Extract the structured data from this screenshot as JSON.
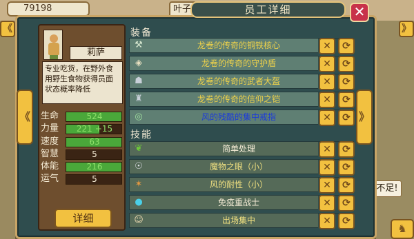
{
  "background": {
    "gold": "79198",
    "label": "叶子",
    "notice": "不足!"
  },
  "dialog": {
    "title": "员工详细",
    "close_symbol": "✕"
  },
  "character": {
    "name": "莉萨",
    "description": "专业吃货，在野外食用野生食物获得员面状态概率降低",
    "detail_button": "详细",
    "stats": [
      {
        "label": "生命",
        "value": "524",
        "bonus": "",
        "fill": 1.0
      },
      {
        "label": "力量",
        "value": "221",
        "bonus": "+15",
        "fill": 0.6
      },
      {
        "label": "速度",
        "value": "63",
        "bonus": "",
        "fill": 1.0
      },
      {
        "label": "智慧",
        "value": "5",
        "bonus": "",
        "fill": 0.0
      },
      {
        "label": "体能",
        "value": "216",
        "bonus": "",
        "fill": 1.0
      },
      {
        "label": "运气",
        "value": "5",
        "bonus": "",
        "fill": 0.0
      }
    ]
  },
  "equipment": {
    "title": "装备",
    "items": [
      {
        "icon": "⚒",
        "name": "龙卷的传奇的铜铁核心",
        "rarity": "legend"
      },
      {
        "icon": "◈",
        "name": "龙卷的传奇的守护盾",
        "rarity": "legend"
      },
      {
        "icon": "☗",
        "name": "龙卷的传奇的武者大盔",
        "rarity": "legend"
      },
      {
        "icon": "♜",
        "name": "龙卷的传奇的信仰之铠",
        "rarity": "legend"
      },
      {
        "icon": "◎",
        "name": "风的残酷的集中戒指",
        "rarity": "rare"
      }
    ]
  },
  "skills": {
    "title": "技能",
    "items": [
      {
        "icon": "❦",
        "name": "简单处理",
        "style": "skillname"
      },
      {
        "icon": "☉",
        "name": "魔物之眼（小）",
        "style": "skilltitle"
      },
      {
        "icon": "✶",
        "name": "风的耐性（小）",
        "style": "skilltitle"
      },
      {
        "icon": "●",
        "name": "免疫重战士",
        "style": "skillname"
      },
      {
        "icon": "☺",
        "name": "出场集中",
        "style": "skilltitle"
      }
    ]
  },
  "actions": {
    "remove_symbol": "✕",
    "swap_symbol": "⟳"
  },
  "nav": {
    "prev_symbol": "《",
    "next_symbol": "》"
  }
}
